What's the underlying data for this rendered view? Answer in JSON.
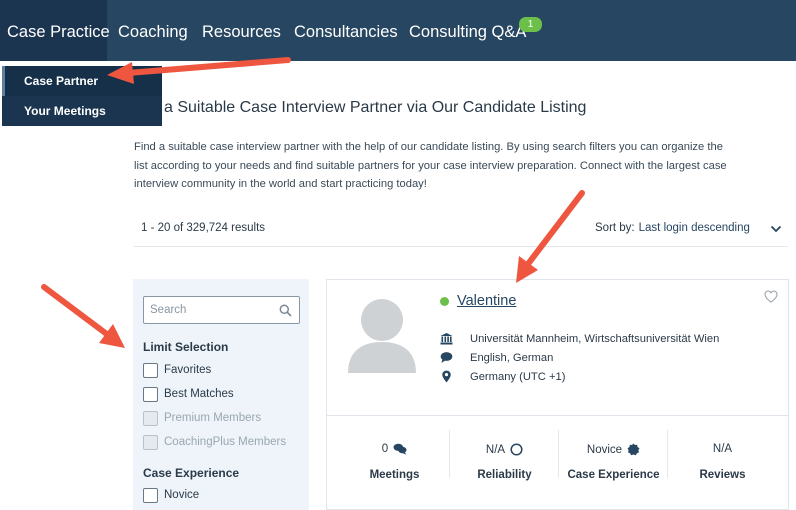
{
  "nav": {
    "items": [
      {
        "label": "Case Practice"
      },
      {
        "label": "Coaching"
      },
      {
        "label": "Resources"
      },
      {
        "label": "Consultancies"
      },
      {
        "label": "Consulting Q&A"
      }
    ],
    "qa_badge": "1"
  },
  "dropdown": {
    "items": [
      {
        "label": "Case Partner"
      },
      {
        "label": "Your Meetings"
      }
    ]
  },
  "page": {
    "title": "a Suitable Case Interview Partner via Our Candidate Listing",
    "intro": "Find a suitable case interview partner with the help of our candidate listing. By using search filters you can organize the list according to your needs and find suitable partners for your case interview preparation. Connect with the largest case interview community in the world and start practicing today!"
  },
  "results": {
    "count_text": "1 - 20 of 329,724 results",
    "sort_label": "Sort by:",
    "sort_value": "Last login descending"
  },
  "filters": {
    "search_placeholder": "Search",
    "limit_heading": "Limit Selection",
    "limit_options": [
      {
        "label": "Favorites",
        "disabled": false
      },
      {
        "label": "Best Matches",
        "disabled": false
      },
      {
        "label": "Premium Members",
        "disabled": true
      },
      {
        "label": "CoachingPlus Members",
        "disabled": true
      }
    ],
    "experience_heading": "Case Experience",
    "experience_options": [
      {
        "label": "Novice",
        "disabled": false
      }
    ]
  },
  "candidate": {
    "name": "Valentine",
    "university": "Universität Mannheim, Wirtschaftsuniversität Wien",
    "languages": "English, German",
    "location": "Germany (UTC +1)",
    "stats": [
      {
        "value": "0",
        "label": "Meetings",
        "icon": "chat-icon"
      },
      {
        "value": "N/A",
        "label": "Reliability",
        "icon": "circle-icon"
      },
      {
        "value": "Novice",
        "label": "Case Experience",
        "icon": "badge-icon"
      },
      {
        "value": "N/A",
        "label": "Reviews",
        "icon": ""
      }
    ]
  },
  "colors": {
    "nav_bg": "#274661",
    "nav_active": "#1b3550",
    "online": "#6cc04a",
    "arrow": "#ef5640"
  }
}
